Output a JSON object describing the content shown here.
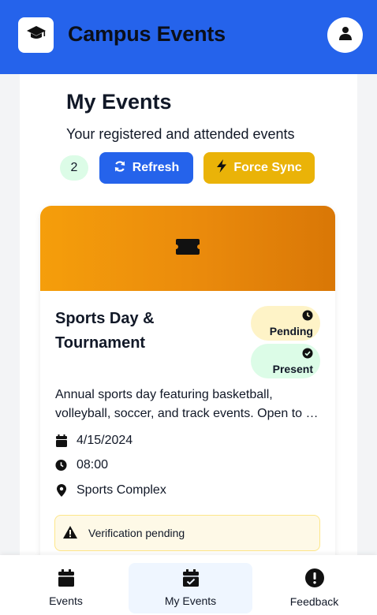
{
  "header": {
    "app_title": "Campus Events",
    "logo_icon": "graduation-cap-icon",
    "avatar_icon": "user-icon",
    "background_color": "#2563eb"
  },
  "page": {
    "title": "My Events",
    "subtitle": "Your registered and attended events",
    "event_count": "2"
  },
  "actions": {
    "refresh_label": "Refresh",
    "force_sync_label": "Force Sync",
    "refresh_color": "#2563eb",
    "force_sync_color": "#eab308"
  },
  "event_card": {
    "banner_icon": "ticket-icon",
    "title": "Sports Day & Tournament",
    "status_pending": "Pending",
    "status_present": "Present",
    "description_line_1": "Annual sports day featuring basketball,",
    "description_line_2": "volleyball, soccer, and track events. Open to all students.",
    "date": "4/15/2024",
    "time": "08:00",
    "location": "Sports Complex",
    "notice": "Verification pending"
  },
  "nav": {
    "events_label": "Events",
    "my_events_label": "My Events",
    "feedback_label": "Feedback",
    "active": "My Events"
  }
}
